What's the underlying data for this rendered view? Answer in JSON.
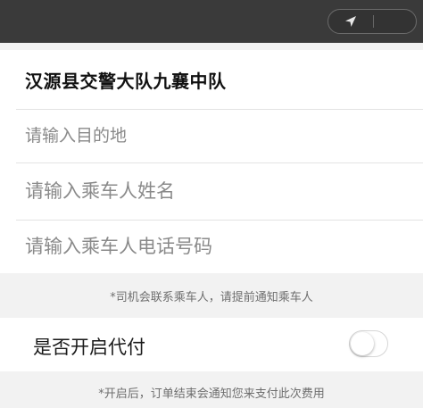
{
  "topbar": {
    "location_icon": "location-arrow-icon"
  },
  "form": {
    "title": "汉源县交警大队九襄中队",
    "destination_placeholder": "请输入目的地",
    "passenger_name_placeholder": "请输入乘车人姓名",
    "passenger_phone_placeholder": "请输入乘车人电话号码"
  },
  "notes": {
    "driver_contact": "*司机会联系乘车人，请提前通知乘车人",
    "proxy_pay": "*开启后，订单结束会通知您来支付此次费用"
  },
  "proxy_pay_toggle": {
    "label": "是否开启代付",
    "enabled": false
  },
  "colors": {
    "topbar": "#3a3a3a",
    "background": "#f2f2f2",
    "card": "#ffffff",
    "placeholder": "#8a8a8a"
  }
}
